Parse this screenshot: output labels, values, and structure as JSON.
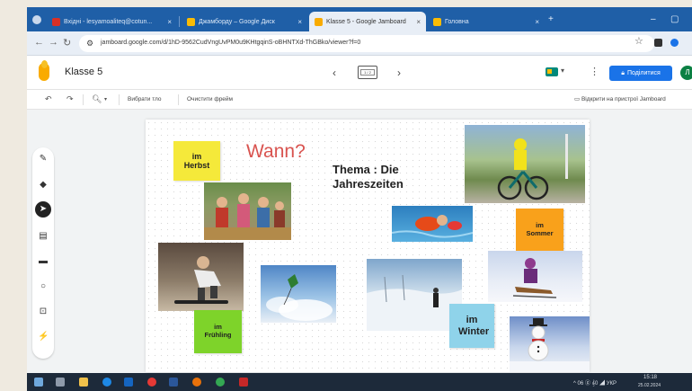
{
  "browser": {
    "tabs": [
      {
        "label": "Вхідні - lesyamoaliteq@cotun...",
        "favicon_color": "#d93025"
      },
      {
        "label": "Джамборду – Google Диск",
        "favicon_color": "#fbbc04"
      },
      {
        "label": "Klasse 5 - Google Jamboard",
        "favicon_color": "#f9ab00"
      },
      {
        "label": "Головна",
        "favicon_color": "#fbbc04"
      }
    ],
    "new_tab": "+",
    "url": "jamboard.google.com/d/1hD-9562CudVngUvPM0u9KHtgqinS-oBHNTXd-ThGBko/viewer?f=0"
  },
  "app": {
    "title": "Klasse 5",
    "frame_counter": "1 / 2",
    "share_label": "Поділитися",
    "avatar_initial": "Л"
  },
  "toolbar": {
    "set_background": "Вибрати тло",
    "clear_frame": "Очистити фрейм",
    "open_on_device": "Відкрити на пристрої Jamboard"
  },
  "board": {
    "wann": "Wann?",
    "thema": "Thema : Die Jahreszeiten",
    "notes": {
      "herbst": "im Herbst",
      "sommer": "im Sommer",
      "fruehling": "im Frühling",
      "winter": "im Winter"
    },
    "colors": {
      "herbst": "#f5e93a",
      "sommer": "#f9a11b",
      "fruehling": "#7ed32a",
      "winter": "#8fd3ea",
      "wann": "#d9534f"
    },
    "photos": [
      "kids-autumn-photo",
      "cyclist-summer-photo",
      "swimmer-photo",
      "skateboard-photo",
      "kite-sky-photo",
      "skier-photo",
      "sledding-photo",
      "snowman-photo"
    ]
  },
  "taskbar": {
    "tray_text": "^ 06 ⓖ 𝄞0 ◢ УКР",
    "time": "15:18",
    "date": "25.02.2024"
  }
}
